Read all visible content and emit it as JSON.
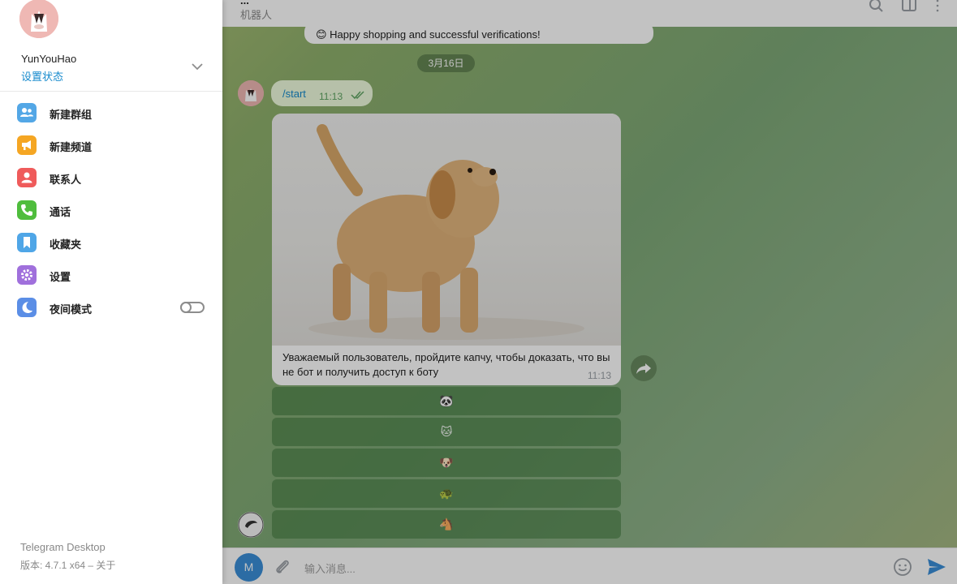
{
  "chat_header": {
    "title": "...",
    "subtitle": "机器人"
  },
  "messages": {
    "greeting": "😊 Happy shopping and successful verifications!",
    "date_divider": "3月16日",
    "start_command": "/start",
    "start_time": "11:13",
    "captcha_caption": "Уважаемый пользователь, пройдите капчу, чтобы доказать, что вы не бот и получить доступ к боту",
    "captcha_time": "11:13"
  },
  "keyboard": {
    "buttons": [
      "🐼",
      "🐱",
      "🐶",
      "🐢",
      "🐴"
    ]
  },
  "input": {
    "avatar_letter": "M",
    "placeholder": "输入消息..."
  },
  "drawer": {
    "user_name": "YunYouHao",
    "user_status": "设置状态",
    "menu": [
      {
        "label": "新建群组",
        "color": "#53a7e6"
      },
      {
        "label": "新建频道",
        "color": "#f5a623"
      },
      {
        "label": "联系人",
        "color": "#ef5b5b"
      },
      {
        "label": "通话",
        "color": "#4fbd3d"
      },
      {
        "label": "收藏夹",
        "color": "#4fa6e7"
      },
      {
        "label": "设置",
        "color": "#a070dc"
      },
      {
        "label": "夜间模式",
        "color": "#5b8ee6"
      }
    ],
    "night_mode_on": false,
    "footer_title": "Telegram Desktop",
    "footer_version": "版本: 4.7.1 x64",
    "footer_about": "– 关于"
  },
  "colors": {
    "accent": "#168acd",
    "sent_bubble": "#effdde",
    "avatar_pink": "#efb8b4"
  }
}
